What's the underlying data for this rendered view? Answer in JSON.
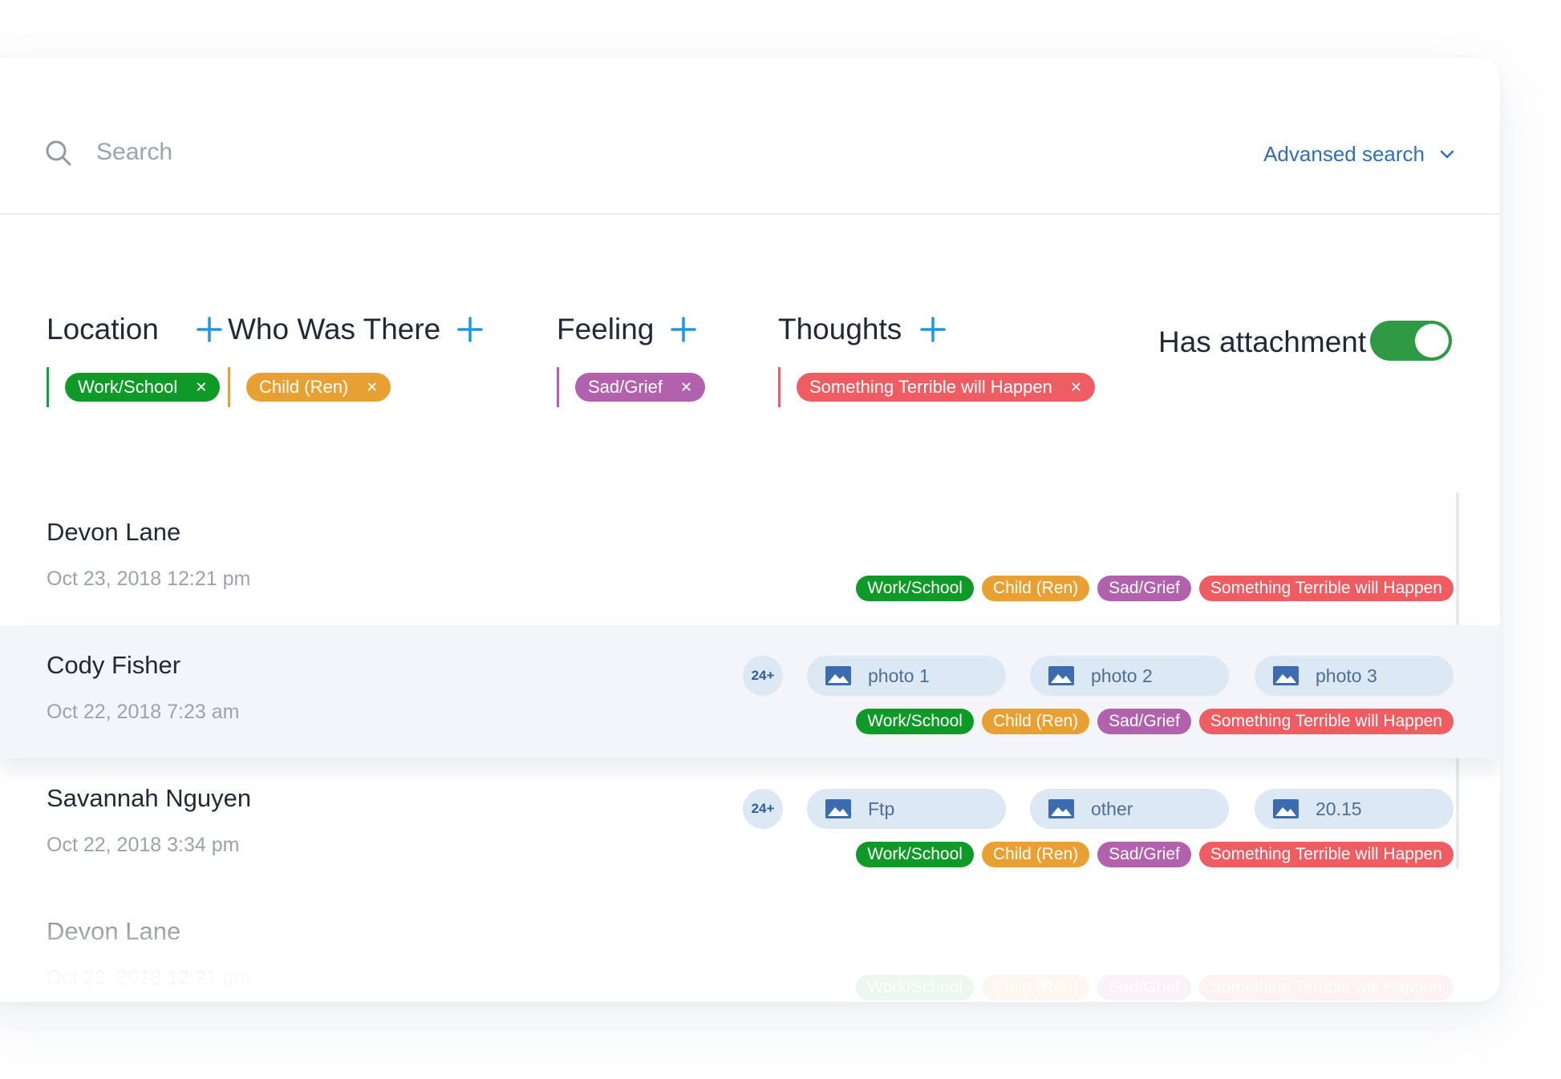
{
  "search": {
    "placeholder": "Search",
    "value": ""
  },
  "advanced_search": {
    "label": "Advansed search"
  },
  "filters": [
    {
      "title": "Location",
      "color": "#13a33a",
      "chip": "Work/School"
    },
    {
      "title": "Who Was There",
      "color": "#e9a032",
      "chip": "Child (Ren)"
    },
    {
      "title": "Feeling",
      "color": "#b261ad",
      "chip": "Sad/Grief"
    },
    {
      "title": "Thoughts",
      "color": "#ef5d62",
      "chip": "Something Terrible will Happen"
    }
  ],
  "has_attachment": {
    "label": "Has attachment",
    "on": true,
    "color": "#2e9a44"
  },
  "tag_colors": {
    "location": "#0f9a27",
    "who": "#e9a032",
    "feeling": "#b261ad",
    "thoughts": "#ef5d62"
  },
  "entries": [
    {
      "name": "Devon Lane",
      "date": "Oct 23, 2018 12:21 pm",
      "badge": "",
      "attachments": [],
      "tags": [
        "Work/School",
        "Child (Ren)",
        "Sad/Grief",
        "Something Terrible will Happen"
      ]
    },
    {
      "name": "Cody Fisher",
      "date": "Oct 22, 2018 7:23 am",
      "badge": "24+",
      "attachments": [
        "photo 1",
        "photo 2",
        "photo 3"
      ],
      "tags": [
        "Work/School",
        "Child (Ren)",
        "Sad/Grief",
        "Something Terrible will Happen"
      ]
    },
    {
      "name": "Savannah Nguyen",
      "date": "Oct 22, 2018 3:34 pm",
      "badge": "24+",
      "attachments": [
        "Ftp",
        "other",
        "20.15"
      ],
      "tags": [
        "Work/School",
        "Child (Ren)",
        "Sad/Grief",
        "Something Terrible will Happen"
      ]
    },
    {
      "name": "Devon Lane",
      "date": "Oct 23, 2018 12:21 pm",
      "badge": "",
      "attachments": [],
      "tags": [
        "Work/School",
        "Child (Ren)",
        "Sad/Grief",
        "Something Terrible will Happen"
      ]
    }
  ],
  "icons": {
    "search": "search-icon",
    "chevron": "chevron-down-icon",
    "plus": "plus-icon",
    "image": "image-icon",
    "remove": "close-icon"
  }
}
